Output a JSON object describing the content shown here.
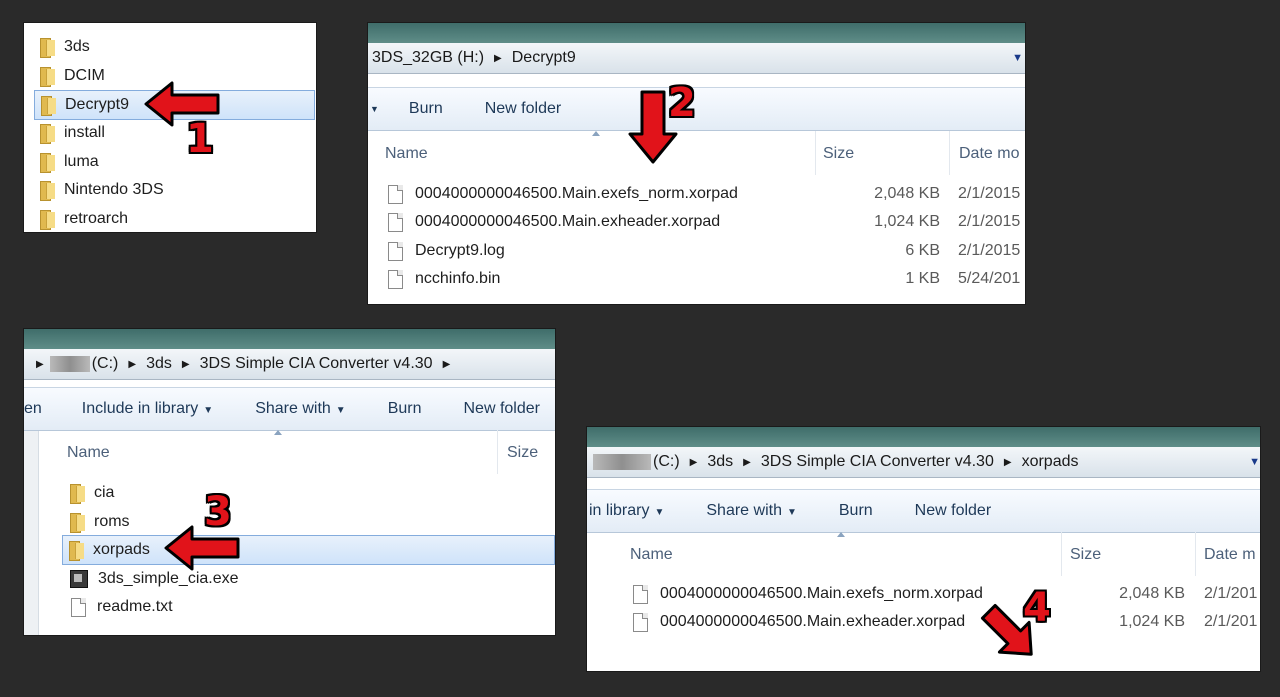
{
  "panel1": {
    "folders": [
      "3ds",
      "DCIM",
      "Decrypt9",
      "install",
      "luma",
      "Nintendo 3DS",
      "retroarch"
    ],
    "selected_index": 2
  },
  "panel2": {
    "breadcrumb": [
      "3DS_32GB (H:)",
      "Decrypt9"
    ],
    "toolbar": [
      "Burn",
      "New folder"
    ],
    "columns": {
      "name": "Name",
      "size": "Size",
      "date": "Date mo"
    },
    "files": [
      {
        "name": "0004000000046500.Main.exefs_norm.xorpad",
        "size": "2,048 KB",
        "date": "2/1/2015"
      },
      {
        "name": "0004000000046500.Main.exheader.xorpad",
        "size": "1,024 KB",
        "date": "2/1/2015"
      },
      {
        "name": "Decrypt9.log",
        "size": "6 KB",
        "date": "2/1/2015"
      },
      {
        "name": "ncchinfo.bin",
        "size": "1 KB",
        "date": "5/24/201"
      }
    ]
  },
  "panel3": {
    "breadcrumb": [
      "(C:)",
      "3ds",
      "3DS Simple CIA Converter v4.30"
    ],
    "toolbar": {
      "partial": "en",
      "include": "Include in library",
      "share": "Share with",
      "burn": "Burn",
      "newfolder": "New folder"
    },
    "columns": {
      "name": "Name",
      "size": "Size"
    },
    "items": [
      {
        "name": "cia",
        "type": "folder"
      },
      {
        "name": "roms",
        "type": "folder"
      },
      {
        "name": "xorpads",
        "type": "folder"
      },
      {
        "name": "3ds_simple_cia.exe",
        "type": "exe"
      },
      {
        "name": "readme.txt",
        "type": "file"
      }
    ]
  },
  "panel4": {
    "breadcrumb": [
      "(C:)",
      "3ds",
      "3DS Simple CIA Converter v4.30",
      "xorpads"
    ],
    "toolbar": {
      "include": "in library",
      "share": "Share with",
      "burn": "Burn",
      "newfolder": "New folder"
    },
    "columns": {
      "name": "Name",
      "size": "Size",
      "date": "Date m"
    },
    "files": [
      {
        "name": "0004000000046500.Main.exefs_norm.xorpad",
        "size": "2,048 KB",
        "date": "2/1/201"
      },
      {
        "name": "0004000000046500.Main.exheader.xorpad",
        "size": "1,024 KB",
        "date": "2/1/201"
      }
    ]
  },
  "annotations": {
    "n1": "1",
    "n2": "2",
    "n3": "3",
    "n4": "4"
  },
  "colors": {
    "arrow": "#e1131a",
    "selection": "#cfe3fa"
  }
}
